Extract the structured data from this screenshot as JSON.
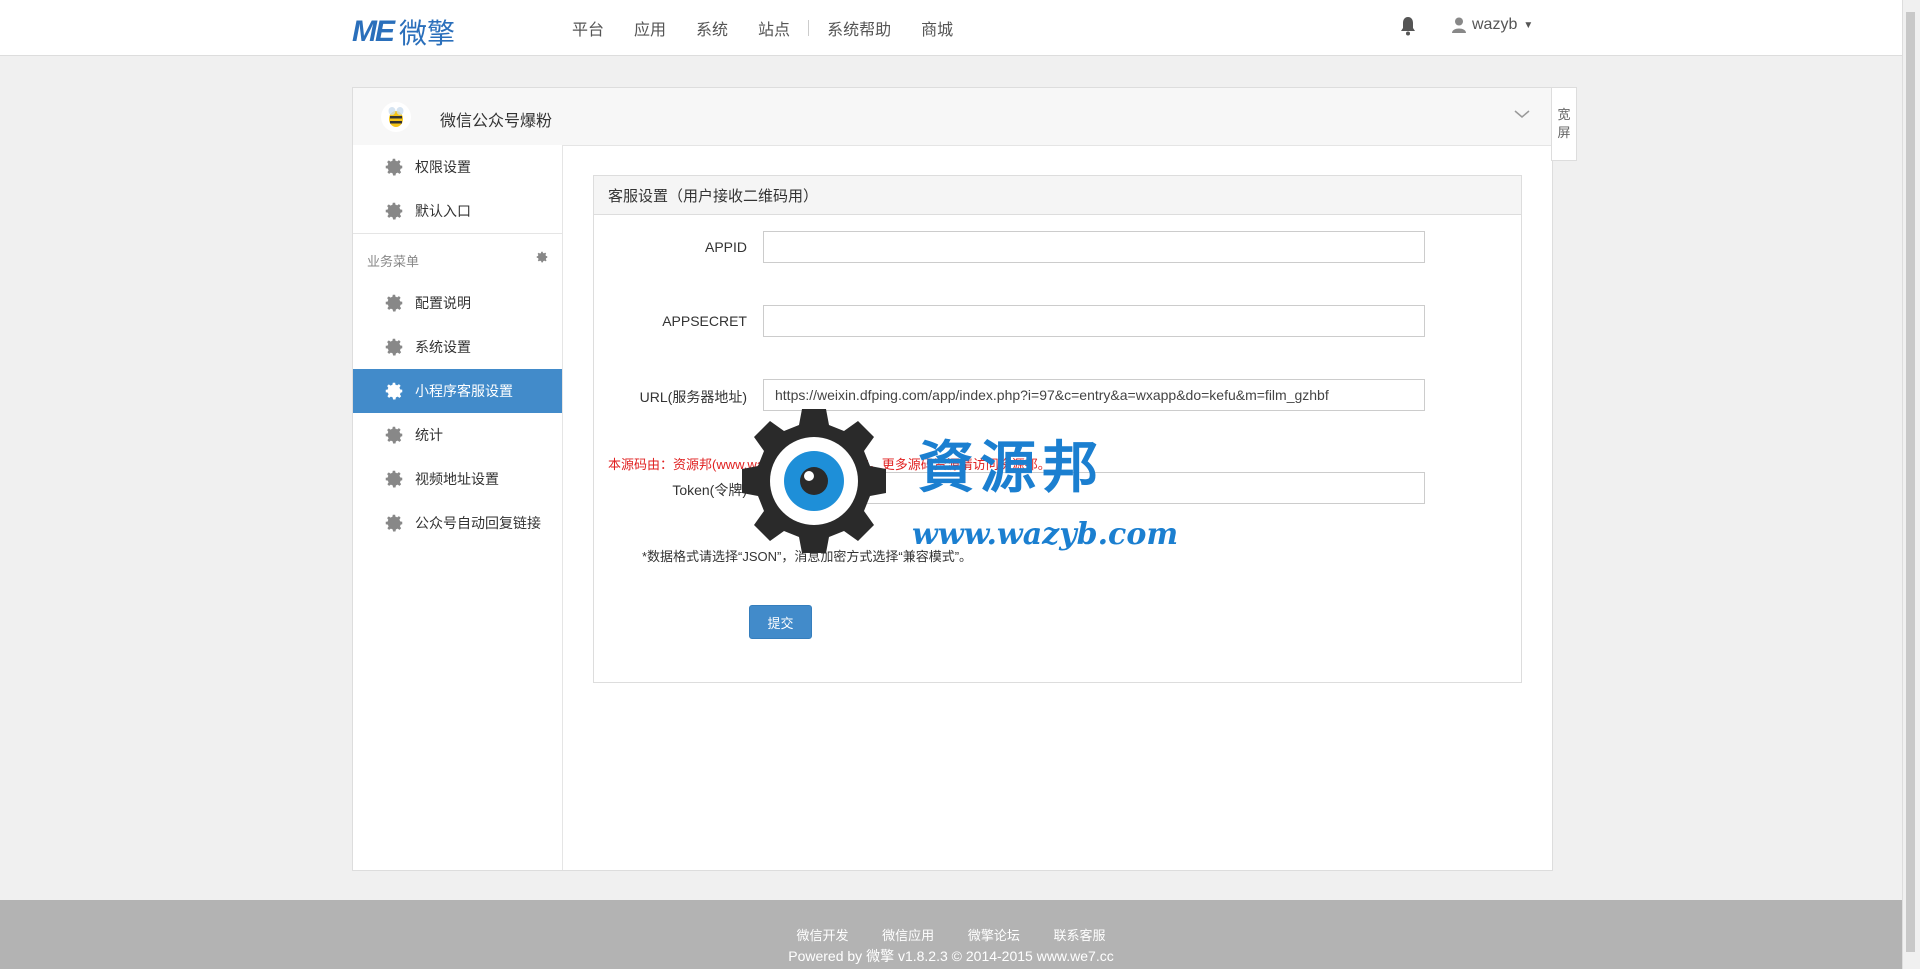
{
  "header": {
    "logo_mark": "ME",
    "logo_cn": "微擎",
    "nav": [
      "平台",
      "应用",
      "系统",
      "站点",
      "系统帮助",
      "商城"
    ],
    "user_name": "wazyb"
  },
  "app": {
    "title": "微信公众号爆粉",
    "wide_screen_label_1": "宽",
    "wide_screen_label_2": "屏"
  },
  "sidebar": {
    "top_items": [
      "权限设置",
      "默认入口"
    ],
    "group_label": "业务菜单",
    "items": [
      "配置说明",
      "系统设置",
      "小程序客服设置",
      "统计",
      "视频地址设置",
      "公众号自动回复链接"
    ],
    "active_index": 2
  },
  "panel": {
    "heading": "客服设置（用户接收二维码用）",
    "fields": [
      {
        "label": "APPID",
        "value": ""
      },
      {
        "label": "APPSECRET",
        "value": ""
      },
      {
        "label": "URL(服务器地址)",
        "value": "https://weixin.dfping.com/app/index.php?i=97&c=entry&a=wxapp&do=kefu&m=film_gzhbf"
      },
      {
        "label": "Token(令牌)",
        "value": "abcdefghijkcaka"
      }
    ],
    "watermark_text": "本源码由：资源邦(www.wazyb.com)整理发布，更多源码资源请访问资源邦。",
    "note": "*数据格式请选择“JSON”，消息加密方式选择“兼容模式”。",
    "submit_label": "提交"
  },
  "watermark": {
    "cn": "資源邦",
    "url": "www.wazyb.com"
  },
  "footer": {
    "links": [
      "微信开发",
      "微信应用",
      "微擎论坛",
      "联系客服"
    ],
    "copyright": "Powered by 微擎 v1.8.2.3 © 2014-2015 www.we7.cc"
  }
}
